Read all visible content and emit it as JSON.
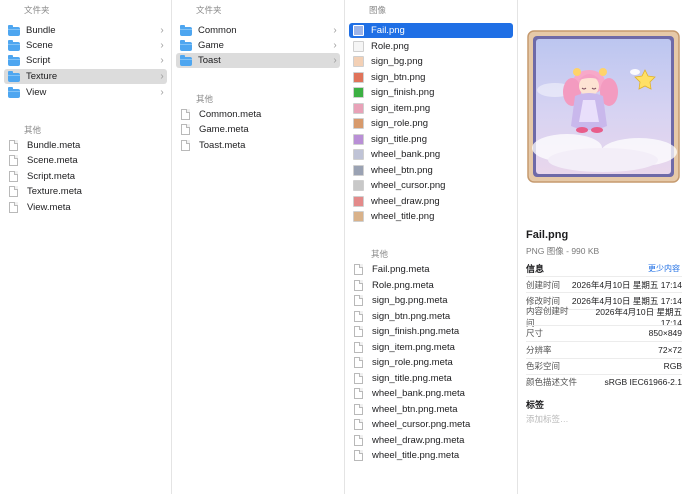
{
  "columns": {
    "c1": {
      "header": "文件夹",
      "folders": [
        {
          "label": "Bundle"
        },
        {
          "label": "Scene"
        },
        {
          "label": "Script"
        },
        {
          "label": "Texture",
          "selected": true
        },
        {
          "label": "View"
        }
      ],
      "other_header": "其他",
      "files": [
        "Bundle.meta",
        "Scene.meta",
        "Script.meta",
        "Texture.meta",
        "View.meta"
      ]
    },
    "c2": {
      "header": "文件夹",
      "folders": [
        {
          "label": "Common"
        },
        {
          "label": "Game"
        },
        {
          "label": "Toast",
          "selected": true
        }
      ],
      "other_header": "其他",
      "files": [
        "Common.meta",
        "Game.meta",
        "Toast.meta"
      ]
    },
    "c3": {
      "header": "图像",
      "images": [
        {
          "label": "Fail.png",
          "icon": "fail-thumb-icon",
          "color": "#9db4e8",
          "active": true
        },
        {
          "label": "Role.png",
          "icon": "role-thumb-icon",
          "color": "#f5f5f5"
        },
        {
          "label": "sign_bg.png",
          "icon": "sign-bg-thumb-icon",
          "color": "#f3d0b5"
        },
        {
          "label": "sign_btn.png",
          "icon": "sign-btn-thumb-icon",
          "color": "#e0735a"
        },
        {
          "label": "sign_finish.png",
          "icon": "checkmark-icon",
          "color": "#3cb043"
        },
        {
          "label": "sign_item.png",
          "icon": "sign-item-thumb-icon",
          "color": "#e8a2b8"
        },
        {
          "label": "sign_role.png",
          "icon": "sign-role-thumb-icon",
          "color": "#d79a6c"
        },
        {
          "label": "sign_title.png",
          "icon": "sign-title-thumb-icon",
          "color": "#b98fd6"
        },
        {
          "label": "wheel_bank.png",
          "icon": "wheel-bank-thumb-icon",
          "color": "#bfc3d6"
        },
        {
          "label": "wheel_btn.png",
          "icon": "wheel-btn-thumb-icon",
          "color": "#9aa2b3"
        },
        {
          "label": "wheel_cursor.png",
          "icon": "wheel-cursor-thumb-icon",
          "color": "#c8c8c8"
        },
        {
          "label": "wheel_draw.png",
          "icon": "wheel-draw-thumb-icon",
          "color": "#e38a8a"
        },
        {
          "label": "wheel_title.png",
          "icon": "wheel-title-thumb-icon",
          "color": "#d9b28a"
        }
      ],
      "other_header": "其他",
      "files": [
        "Fail.png.meta",
        "Role.png.meta",
        "sign_bg.png.meta",
        "sign_btn.png.meta",
        "sign_finish.png.meta",
        "sign_item.png.meta",
        "sign_role.png.meta",
        "sign_title.png.meta",
        "wheel_bank.png.meta",
        "wheel_btn.png.meta",
        "wheel_cursor.png.meta",
        "wheel_draw.png.meta",
        "wheel_title.png.meta"
      ]
    }
  },
  "preview": {
    "filename": "Fail.png",
    "kind": "PNG 图像 - 990 KB",
    "info_title": "信息",
    "less_link": "更少内容",
    "info": [
      {
        "k": "创建时间",
        "v": "2026年4月10日 星期五 17:14"
      },
      {
        "k": "修改时间",
        "v": "2026年4月10日 星期五 17:14"
      },
      {
        "k": "内容创建时间",
        "v": "2026年4月10日 星期五 17:14"
      },
      {
        "k": "尺寸",
        "v": "850×849"
      },
      {
        "k": "分辨率",
        "v": "72×72"
      },
      {
        "k": "色彩空间",
        "v": "RGB"
      },
      {
        "k": "颜色描述文件",
        "v": "sRGB IEC61966-2.1"
      }
    ],
    "tags_title": "标签",
    "tags_placeholder": "添加标签…"
  }
}
